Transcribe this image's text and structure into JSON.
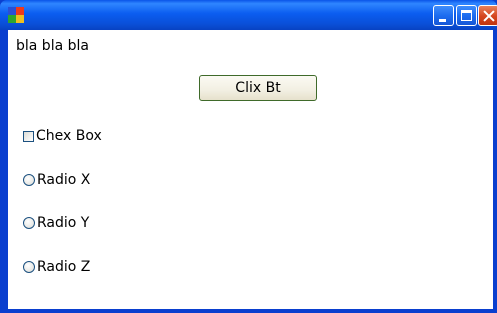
{
  "window": {
    "icon": "app-icon",
    "controls": {
      "minimize": "minimize-icon",
      "maximize": "maximize-icon",
      "close": "close-icon"
    }
  },
  "content": {
    "label": "bla bla bla",
    "button_label": "Clix Bt",
    "checkbox_label": "Chex Box",
    "checkbox_checked": false,
    "radios": [
      {
        "label": "Radio X",
        "selected": false
      },
      {
        "label": "Radio Y",
        "selected": false
      },
      {
        "label": "Radio Z",
        "selected": false
      }
    ]
  }
}
